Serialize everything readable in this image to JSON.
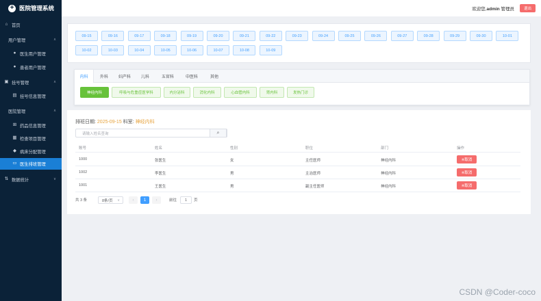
{
  "app": {
    "title": "医院管理系统"
  },
  "header": {
    "welcome_prefix": "欢迎您,",
    "username": "admin",
    "role": "管理员",
    "exit_label": "退出"
  },
  "sidebar": {
    "home": "首页",
    "groups": [
      {
        "label": "用户管理",
        "items": [
          "医生用户管理",
          "患者用户管理"
        ]
      },
      {
        "label": "挂号管理",
        "items": [
          "挂号信息管理"
        ]
      },
      {
        "label": "医院管理",
        "items": [
          "药品信息管理",
          "检查项目管理",
          "病床分配管理",
          "医生排班管理"
        ]
      }
    ],
    "stats": "数据统计",
    "active_item": "医生排班管理"
  },
  "dates": [
    "09-15",
    "09-16",
    "09-17",
    "09-18",
    "09-19",
    "09-20",
    "09-21",
    "09-22",
    "09-23",
    "09-24",
    "09-25",
    "09-26",
    "09-27",
    "09-28",
    "09-29",
    "09-30",
    "10-01",
    "10-02",
    "10-03",
    "10-04",
    "10-05",
    "10-06",
    "10-07",
    "10-08",
    "10-09"
  ],
  "departments": {
    "tabs": [
      "内科",
      "外科",
      "妇产科",
      "儿科",
      "五官科",
      "中医科",
      "其他"
    ],
    "active_tab": "内科",
    "sub_departments": [
      "神经内科",
      "呼吸与危重症医学科",
      "内分泌科",
      "消化内科",
      "心血管内科",
      "肾内科",
      "发热门诊"
    ],
    "active_sub": "神经内科"
  },
  "schedule": {
    "date_label": "排班日期:",
    "date_value": "2025-09-15",
    "dept_label": "科室:",
    "dept_value": "神经内科",
    "search_placeholder": "请输入姓名查询",
    "columns": [
      "账号",
      "姓名",
      "性别",
      "职位",
      "部门",
      "操作"
    ],
    "rows": [
      {
        "account": "1000",
        "name": "张医生",
        "gender": "女",
        "position": "主任医师",
        "dept": "神经内科",
        "action": "※取消"
      },
      {
        "account": "1002",
        "name": "李医生",
        "gender": "男",
        "position": "主治医师",
        "dept": "神经内科",
        "action": "※取消"
      },
      {
        "account": "1001",
        "name": "王医生",
        "gender": "男",
        "position": "副主任医师",
        "dept": "神经内科",
        "action": "※取消"
      }
    ]
  },
  "pagination": {
    "total": "共 3 条",
    "page_size": "8条/页",
    "current": "1",
    "goto_label": "前往",
    "goto_value": "1",
    "goto_unit": "页"
  },
  "watermark": "CSDN @Coder-coco"
}
